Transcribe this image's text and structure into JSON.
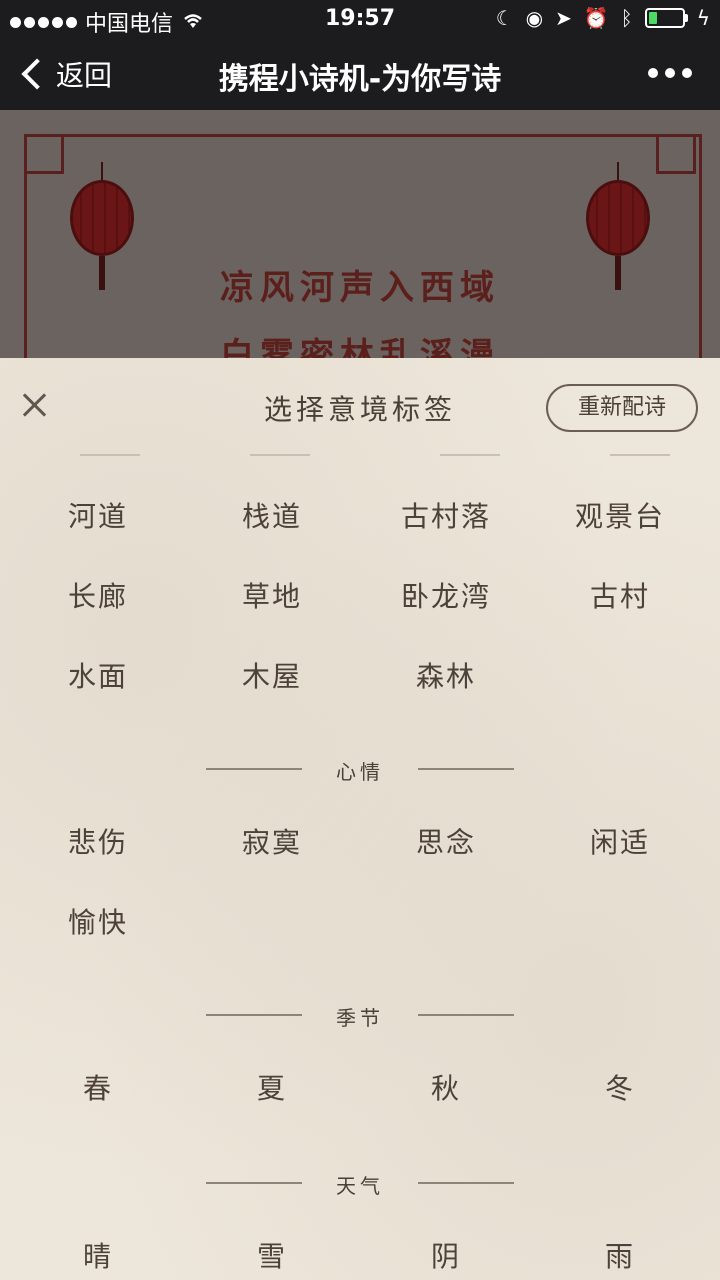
{
  "status_bar": {
    "carrier": "中国电信",
    "time": "19:57"
  },
  "nav": {
    "back_label": "返回",
    "title": "携程小诗机-为你写诗"
  },
  "poem": {
    "lines": [
      "凉风河声入西域",
      "白雾密林乱溪漫"
    ]
  },
  "sheet": {
    "title": "选择意境标签",
    "rematch_label": "重新配诗",
    "scene_tags": [
      "河道",
      "栈道",
      "古村落",
      "观景台",
      "长廊",
      "草地",
      "卧龙湾",
      "古村",
      "水面",
      "木屋",
      "森林"
    ],
    "mood": {
      "label": "心情",
      "tags": [
        "悲伤",
        "寂寞",
        "思念",
        "闲适",
        "愉快"
      ]
    },
    "season": {
      "label": "季节",
      "tags": [
        "春",
        "夏",
        "秋",
        "冬"
      ]
    },
    "weather": {
      "label": "天气",
      "tags": [
        "晴",
        "雪",
        "阴",
        "雨"
      ]
    }
  }
}
